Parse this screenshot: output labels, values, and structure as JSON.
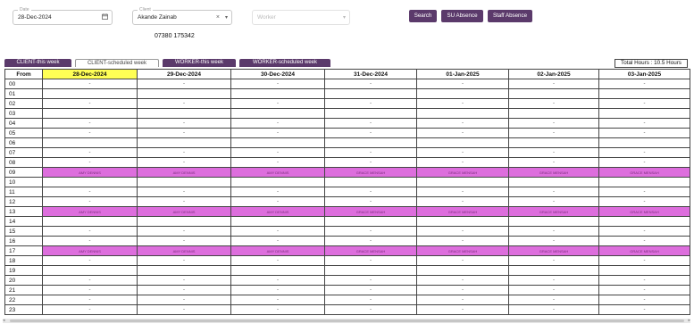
{
  "filters": {
    "date": {
      "legend": "Date",
      "value": "28-Dec-2024",
      "icon": "calendar-icon"
    },
    "client": {
      "legend": "Client",
      "value": "Akande Zainab",
      "clear": "×",
      "caret": "▾"
    },
    "worker": {
      "placeholder": "Worker",
      "caret": "▾"
    },
    "phone": "07380 175342"
  },
  "buttons": {
    "search": "Search",
    "su_absence": "SU Absence",
    "staff_absence": "Staff Absence"
  },
  "tabs": [
    {
      "label": "CLIENT-this week",
      "active": false
    },
    {
      "label": "CLIENT-scheduled week",
      "active": true
    },
    {
      "label": "WORKER-this week",
      "active": false
    },
    {
      "label": "WORKER-scheduled week",
      "active": false
    }
  ],
  "total_hours": "Total Hours : 10.5 Hours",
  "schedule": {
    "from_label": "From",
    "days": [
      "28-Dec-2024",
      "29-Dec-2024",
      "30-Dec-2024",
      "31-Dec-2024",
      "01-Jan-2025",
      "02-Jan-2025",
      "03-Jan-2025"
    ],
    "highlight_day_index": 0,
    "empty_mark": "-",
    "rows": [
      {
        "hour": "00",
        "cells": [
          "-",
          "-",
          "-",
          "-",
          "-",
          "-",
          "-"
        ]
      },
      {
        "hour": "01",
        "cells": [
          "",
          "",
          "",
          "",
          "",
          "",
          ""
        ]
      },
      {
        "hour": "02",
        "cells": [
          "-",
          "-",
          "-",
          "-",
          "-",
          "-",
          "-"
        ]
      },
      {
        "hour": "03",
        "cells": [
          "",
          "",
          "",
          "",
          "",
          "",
          ""
        ]
      },
      {
        "hour": "04",
        "cells": [
          "-",
          "-",
          "-",
          "-",
          "-",
          "-",
          "-"
        ]
      },
      {
        "hour": "05",
        "cells": [
          "-",
          "-",
          "-",
          "-",
          "-",
          "-",
          "-"
        ]
      },
      {
        "hour": "06",
        "cells": [
          "",
          "",
          "",
          "",
          "",
          "",
          ""
        ]
      },
      {
        "hour": "07",
        "cells": [
          "-",
          "-",
          "-",
          "-",
          "-",
          "-",
          "-"
        ]
      },
      {
        "hour": "08",
        "cells": [
          "-",
          "-",
          "-",
          "-",
          "-",
          "-",
          "-"
        ]
      },
      {
        "hour": "09",
        "booked": true,
        "cells": [
          "AMY DENNIS",
          "AMY DENNIS",
          "AMY DENNIS",
          "GRACE MENSAH",
          "GRACE MENSAH",
          "GRACE MENSAH",
          "GRACE MENSAH"
        ]
      },
      {
        "hour": "10",
        "cells": [
          "",
          "",
          "",
          "",
          "",
          "",
          ""
        ]
      },
      {
        "hour": "11",
        "cells": [
          "-",
          "-",
          "-",
          "-",
          "-",
          "-",
          "-"
        ]
      },
      {
        "hour": "12",
        "cells": [
          "-",
          "-",
          "-",
          "-",
          "-",
          "-",
          "-"
        ]
      },
      {
        "hour": "13",
        "booked": true,
        "cells": [
          "AMY DENNIS",
          "AMY DENNIS",
          "AMY DENNIS",
          "GRACE MENSAH",
          "GRACE MENSAH",
          "GRACE MENSAH",
          "GRACE MENSAH"
        ]
      },
      {
        "hour": "14",
        "cells": [
          "",
          "",
          "",
          "",
          "",
          "",
          ""
        ]
      },
      {
        "hour": "15",
        "cells": [
          "-",
          "-",
          "-",
          "-",
          "-",
          "-",
          "-"
        ]
      },
      {
        "hour": "16",
        "cells": [
          "-",
          "-",
          "-",
          "-",
          "-",
          "-",
          "-"
        ]
      },
      {
        "hour": "17",
        "booked": true,
        "cells": [
          "AMY DENNIS",
          "AMY DENNIS",
          "AMY DENNIS",
          "GRACE MENSAH",
          "GRACE MENSAH",
          "GRACE MENSAH",
          "GRACE MENSAH"
        ]
      },
      {
        "hour": "18",
        "cells": [
          "-",
          "-",
          "-",
          "-",
          "-",
          "-",
          "-"
        ]
      },
      {
        "hour": "19",
        "cells": [
          "",
          "",
          "",
          "",
          "",
          "",
          ""
        ]
      },
      {
        "hour": "20",
        "cells": [
          "-",
          "-",
          "-",
          "-",
          "-",
          "-",
          "-"
        ]
      },
      {
        "hour": "21",
        "cells": [
          "-",
          "-",
          "-",
          "-",
          "-",
          "-",
          "-"
        ]
      },
      {
        "hour": "22",
        "cells": [
          "-",
          "-",
          "-",
          "-",
          "-",
          "-",
          "-"
        ]
      },
      {
        "hour": "23",
        "cells": [
          "-",
          "-",
          "-",
          "-",
          "-",
          "-",
          "-"
        ]
      }
    ]
  },
  "scrollbar": {
    "left_arrow": "◂",
    "right_arrow": "▸"
  },
  "colors": {
    "accent": "#5b3a6b",
    "booked": "#dd6edd",
    "highlight": "#ffff55"
  }
}
